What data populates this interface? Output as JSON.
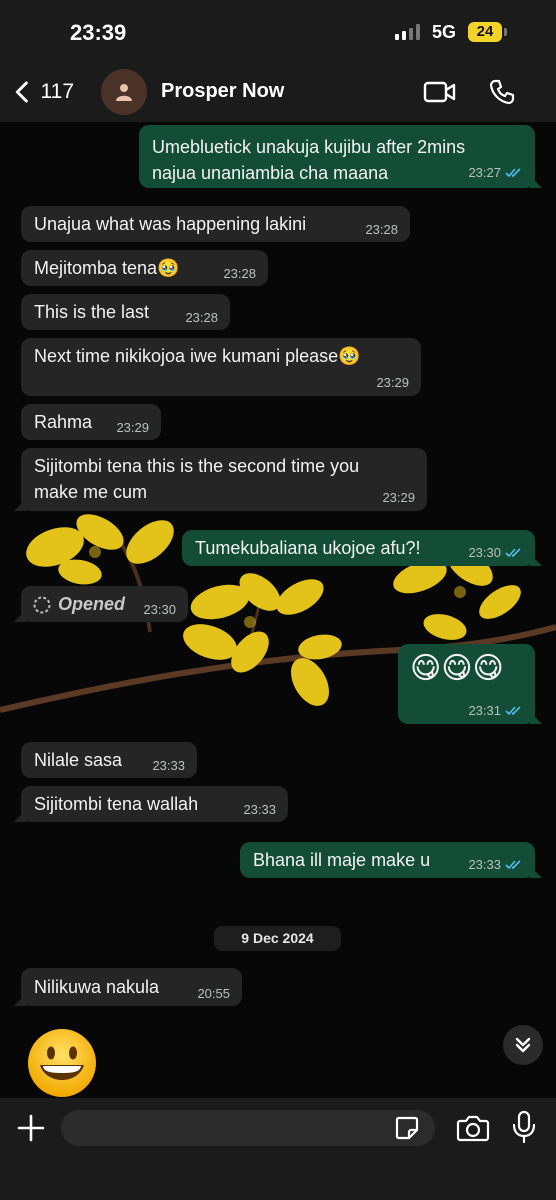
{
  "status_bar": {
    "time": "23:39",
    "network": "5G",
    "battery": "24"
  },
  "header": {
    "back_count": "117",
    "contact_name": "Prosper Now"
  },
  "colors": {
    "incoming_bubble": "#252525",
    "outgoing_bubble": "#134d37",
    "read_ticks": "#53bdeb",
    "battery": "#f4d428"
  },
  "messages": [
    {
      "dir": "out",
      "lines": [
        "Umebluetick unakuja kujibu after 2mins",
        "najua unaniambia cha maana"
      ],
      "time": "23:27",
      "status": "read"
    },
    {
      "dir": "in",
      "lines": [
        "Unajua what was happening lakini"
      ],
      "time": "23:28"
    },
    {
      "dir": "in",
      "lines": [
        "Mejitomba tena🥹"
      ],
      "time": "23:28"
    },
    {
      "dir": "in",
      "lines": [
        "This is the last"
      ],
      "time": "23:28"
    },
    {
      "dir": "in",
      "lines": [
        "Next time nikikojoa iwe kumani please🥹"
      ],
      "time": "23:29"
    },
    {
      "dir": "in",
      "lines": [
        "Rahma"
      ],
      "time": "23:29"
    },
    {
      "dir": "in",
      "lines": [
        "Sijitombi tena this is the second time you",
        "make me cum"
      ],
      "time": "23:29"
    },
    {
      "dir": "out",
      "lines": [
        "Tumekubaliana ukojoe afu?!"
      ],
      "time": "23:30",
      "status": "read"
    },
    {
      "dir": "in",
      "lines": [
        "Opened"
      ],
      "time": "23:30",
      "kind": "view-once"
    },
    {
      "dir": "out",
      "lines": [
        "😋😋😋"
      ],
      "time": "23:31",
      "status": "read"
    },
    {
      "dir": "in",
      "lines": [
        "Nilale sasa"
      ],
      "time": "23:33"
    },
    {
      "dir": "in",
      "lines": [
        "Sijitombi tena wallah"
      ],
      "time": "23:33"
    },
    {
      "dir": "out",
      "lines": [
        "Bhana ill maje make u"
      ],
      "time": "23:33",
      "status": "read"
    },
    {
      "dir": "in",
      "lines": [
        "Nilikuwa nakula"
      ],
      "time": "20:55"
    }
  ],
  "date_separator": "9 Dec 2024",
  "large_emoji": "grinning-face",
  "input": {
    "value": "",
    "placeholder": ""
  },
  "icons": [
    "back-chevron-icon",
    "person-icon",
    "video-call-icon",
    "phone-icon",
    "chevrons-down-icon",
    "plus-icon",
    "sticker-icon",
    "camera-icon",
    "microphone-icon"
  ]
}
